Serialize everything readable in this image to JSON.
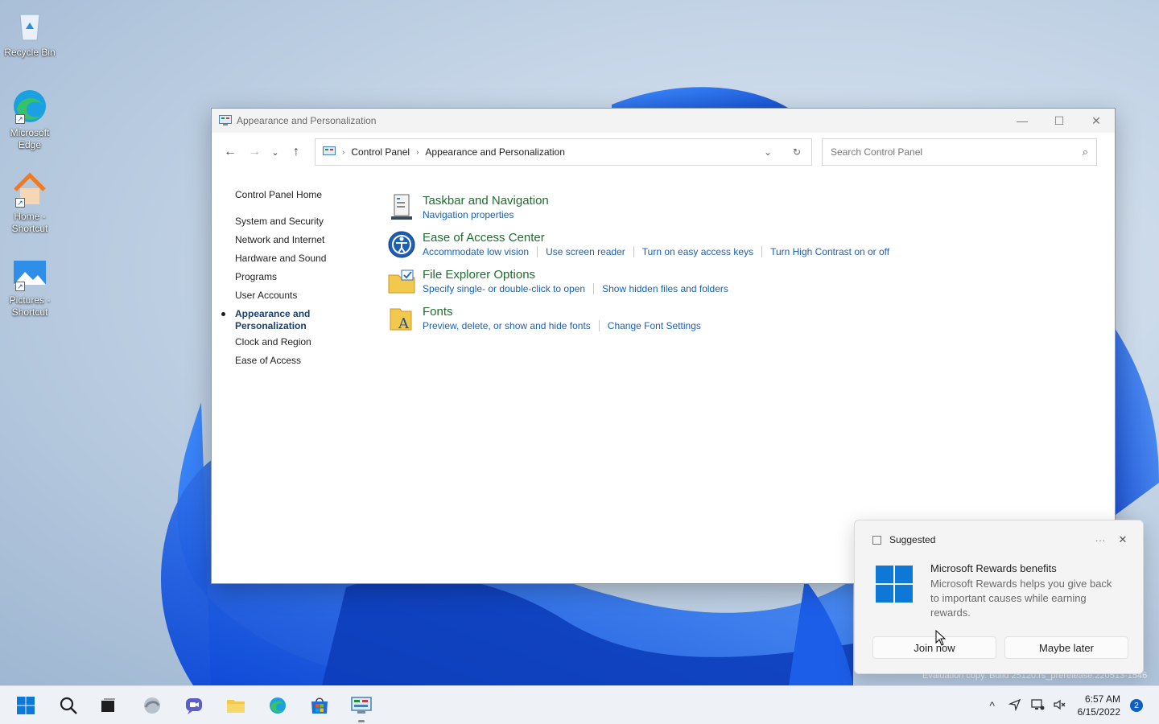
{
  "desktop": {
    "icons": [
      {
        "label": "Recycle Bin",
        "icon": "recycle-bin-icon"
      },
      {
        "label": "Microsoft Edge",
        "icon": "edge-icon"
      },
      {
        "label": "Home - Shortcut",
        "icon": "home-icon"
      },
      {
        "label": "Pictures - Shortcut",
        "icon": "pictures-icon"
      }
    ]
  },
  "window": {
    "title": "Appearance and Personalization",
    "controls": {
      "minimize": "—",
      "maximize": "☐",
      "close": "✕"
    },
    "nav": {
      "back": "←",
      "forward": "→",
      "recent": "⌄",
      "up": "↑"
    },
    "breadcrumb": [
      "Control Panel",
      "Appearance and Personalization"
    ],
    "breadcrumb_sep": "›",
    "address_dropdown": "⌄",
    "refresh": "↻",
    "search_placeholder": "Search Control Panel",
    "sidebar": {
      "home": "Control Panel Home",
      "items": [
        "System and Security",
        "Network and Internet",
        "Hardware and Sound",
        "Programs",
        "User Accounts",
        "Appearance and Personalization",
        "Clock and Region",
        "Ease of Access"
      ],
      "active_index": 5
    },
    "categories": [
      {
        "title": "Taskbar and Navigation",
        "icon": "taskbar-icon",
        "links": [
          "Navigation properties"
        ]
      },
      {
        "title": "Ease of Access Center",
        "icon": "ease-of-access-icon",
        "links": [
          "Accommodate low vision",
          "Use screen reader",
          "Turn on easy access keys",
          "Turn High Contrast on or off"
        ]
      },
      {
        "title": "File Explorer Options",
        "icon": "folder-options-icon",
        "links": [
          "Specify single- or double-click to open",
          "Show hidden files and folders"
        ]
      },
      {
        "title": "Fonts",
        "icon": "fonts-icon",
        "links": [
          "Preview, delete, or show and hide fonts",
          "Change Font Settings"
        ]
      }
    ]
  },
  "notification": {
    "header": "Suggested",
    "more": "···",
    "close": "✕",
    "title": "Microsoft Rewards benefits",
    "message": "Microsoft Rewards helps you give back to important causes while earning rewards.",
    "primary": "Join now",
    "secondary": "Maybe later"
  },
  "watermark": "Evaluation copy. Build 25120.rs_prerelease.220513-1546",
  "taskbar": {
    "apps": [
      "start-icon",
      "search-icon",
      "task-view-icon",
      "widgets-icon",
      "chat-icon",
      "file-explorer-icon",
      "edge-icon",
      "store-icon",
      "control-panel-icon"
    ],
    "tray": {
      "chevron": "^",
      "time": "6:57 AM",
      "date": "6/15/2022",
      "badge": "2"
    }
  },
  "colors": {
    "link": "#1a5fb4",
    "category_title": "#1e6c2e",
    "accent": "#0e78d7"
  }
}
